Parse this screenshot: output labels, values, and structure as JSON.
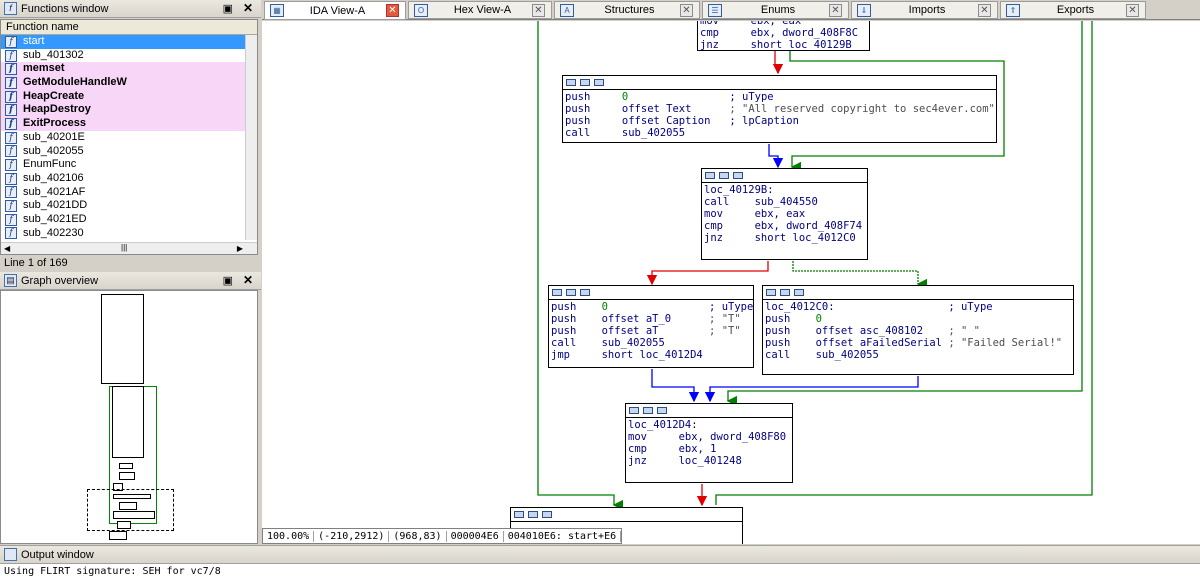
{
  "functions_window": {
    "title": "Functions window",
    "column_header": "Function name",
    "items": [
      {
        "name": "start",
        "kind": "selected"
      },
      {
        "name": "sub_401302",
        "kind": "normal"
      },
      {
        "name": "memset",
        "kind": "lib"
      },
      {
        "name": "GetModuleHandleW",
        "kind": "lib"
      },
      {
        "name": "HeapCreate",
        "kind": "lib"
      },
      {
        "name": "HeapDestroy",
        "kind": "lib"
      },
      {
        "name": "ExitProcess",
        "kind": "lib"
      },
      {
        "name": "sub_40201E",
        "kind": "normal"
      },
      {
        "name": "sub_402055",
        "kind": "normal"
      },
      {
        "name": "EnumFunc",
        "kind": "normal"
      },
      {
        "name": "sub_402106",
        "kind": "normal"
      },
      {
        "name": "sub_4021AF",
        "kind": "normal"
      },
      {
        "name": "sub_4021DD",
        "kind": "normal"
      },
      {
        "name": "sub_4021ED",
        "kind": "normal"
      },
      {
        "name": "sub_402230",
        "kind": "normal"
      }
    ],
    "line_status": "Line 1 of 169"
  },
  "graph_overview": {
    "title": "Graph overview"
  },
  "tabs": [
    {
      "label": "IDA View-A",
      "icon": "graph-icon",
      "active": true
    },
    {
      "label": "Hex View-A",
      "icon": "hex-icon",
      "active": false
    },
    {
      "label": "Structures",
      "icon": "struct-icon",
      "active": false
    },
    {
      "label": "Enums",
      "icon": "enum-icon",
      "active": false
    },
    {
      "label": "Imports",
      "icon": "imports-icon",
      "active": false
    },
    {
      "label": "Exports",
      "icon": "exports-icon",
      "active": false
    }
  ],
  "graph": {
    "node_top": {
      "lines": [
        {
          "m": "mov",
          "o": "ebx, eax"
        },
        {
          "m": "cmp",
          "o": "ebx, dword_408F8C"
        },
        {
          "m": "jnz",
          "o": "short loc_40129B"
        }
      ]
    },
    "node_msg": {
      "lines": [
        {
          "m": "push",
          "o": "0",
          "c": "; uType"
        },
        {
          "m": "push",
          "o": "offset Text",
          "c": "; \"All reserved copyright to sec4ever.com\""
        },
        {
          "m": "push",
          "o": "offset Caption",
          "c": "; lpCaption"
        },
        {
          "m": "call",
          "o": "sub_402055",
          "c": ""
        }
      ]
    },
    "node_40129b": {
      "label": "loc_40129B:",
      "lines": [
        {
          "m": "call",
          "o": "sub_404550"
        },
        {
          "m": "mov",
          "o": "ebx, eax"
        },
        {
          "m": "cmp",
          "o": "ebx, dword_408F74"
        },
        {
          "m": "jnz",
          "o": "short loc_4012C0"
        }
      ]
    },
    "node_t": {
      "lines": [
        {
          "m": "push",
          "o": "0",
          "c": "; uType"
        },
        {
          "m": "push",
          "o": "offset aT_0",
          "c": "; \"T\""
        },
        {
          "m": "push",
          "o": "offset aT",
          "c": "; \"T\""
        },
        {
          "m": "call",
          "o": "sub_402055",
          "c": ""
        },
        {
          "m": "jmp",
          "o": "short loc_4012D4",
          "c": ""
        }
      ]
    },
    "node_4012c0": {
      "label": "loc_4012C0:",
      "label_comment": "; uType",
      "lines": [
        {
          "m": "push",
          "o": "0",
          "c": ""
        },
        {
          "m": "push",
          "o": "offset asc_408102",
          "c": "; \" \""
        },
        {
          "m": "push",
          "o": "offset aFailedSerial",
          "c": "; \"Failed Serial!\""
        },
        {
          "m": "call",
          "o": "sub_402055",
          "c": ""
        }
      ]
    },
    "node_4012d4": {
      "label": "loc_4012D4:",
      "lines": [
        {
          "m": "mov",
          "o": "ebx, dword_408F80"
        },
        {
          "m": "cmp",
          "o": "ebx, 1"
        },
        {
          "m": "jnz",
          "o": "loc_401248"
        }
      ]
    },
    "edge_colors": {
      "true": "#008000",
      "false": "#e00000",
      "uncond": "#0000ff"
    }
  },
  "graph_status": [
    "100.00%",
    "(-210,2912)",
    "(968,83)",
    "000004E6",
    "004010E6: start+E6"
  ],
  "output_window": {
    "title": "Output window",
    "text": "Using FLIRT signature: SEH for vc7/8"
  }
}
